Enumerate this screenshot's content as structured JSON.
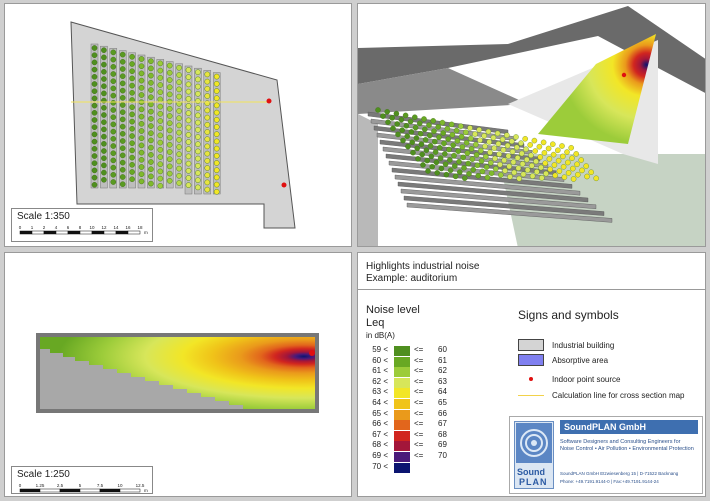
{
  "panels": {
    "plan": {
      "scale_label": "Scale 1:350",
      "ticks": [
        "0",
        "1",
        "2",
        "4",
        "6",
        "8",
        "10",
        "12",
        "14",
        "16",
        "18"
      ],
      "unit": "m"
    },
    "section": {
      "scale_label": "Scale 1:250",
      "ticks": [
        "0",
        "1.25",
        "2.5",
        "5",
        "7.5",
        "10",
        "12.5"
      ],
      "unit": "m"
    },
    "legend": {
      "title_line1": "Highlights industrial noise",
      "title_line2": "Example: auditorium",
      "noise_title": "Noise level",
      "noise_metric": "Leq",
      "noise_unit": "in dB(A)",
      "classes": [
        {
          "lo": "59 <",
          "op": "<=",
          "hi": "60",
          "color": "#4f8f1f"
        },
        {
          "lo": "60 <",
          "op": "<=",
          "hi": "61",
          "color": "#68a823"
        },
        {
          "lo": "61 <",
          "op": "<=",
          "hi": "62",
          "color": "#9ccc3a"
        },
        {
          "lo": "62 <",
          "op": "<=",
          "hi": "63",
          "color": "#d7e65a"
        },
        {
          "lo": "63 <",
          "op": "<=",
          "hi": "64",
          "color": "#f2e626"
        },
        {
          "lo": "64 <",
          "op": "<=",
          "hi": "65",
          "color": "#f0c419"
        },
        {
          "lo": "65 <",
          "op": "<=",
          "hi": "66",
          "color": "#ea9a1b"
        },
        {
          "lo": "66 <",
          "op": "<=",
          "hi": "67",
          "color": "#e2661c"
        },
        {
          "lo": "67 <",
          "op": "<=",
          "hi": "68",
          "color": "#d1251f"
        },
        {
          "lo": "68 <",
          "op": "<=",
          "hi": "69",
          "color": "#a3163a"
        },
        {
          "lo": "69 <",
          "op": "<=",
          "hi": "70",
          "color": "#4a1a7a"
        },
        {
          "lo": "70 <",
          "op": "",
          "hi": "",
          "color": "#0b1470"
        }
      ],
      "signs_title": "Signs and symbols",
      "signs": [
        {
          "label": "Industrial building",
          "kind": "building"
        },
        {
          "label": "Absorptive area",
          "kind": "absorptive"
        },
        {
          "label": "Indoor point source",
          "kind": "source"
        },
        {
          "label": "Calculation line for cross section map",
          "kind": "line"
        }
      ]
    },
    "company": {
      "name": "SoundPLAN GmbH",
      "desc1": "Software Designers and Consulting Engineers for",
      "desc2": "Noise Control • Air Pollution • Environmental Protection",
      "address": "SoundPLAN GmbH Etzwiesenberg 15 | D-71522 Backnang",
      "phone": "Phone: +49.7191.9144-0 | Fax:+49.7191.9144-24",
      "logo_top": "Sound",
      "logo_bottom": "PLAN"
    }
  }
}
